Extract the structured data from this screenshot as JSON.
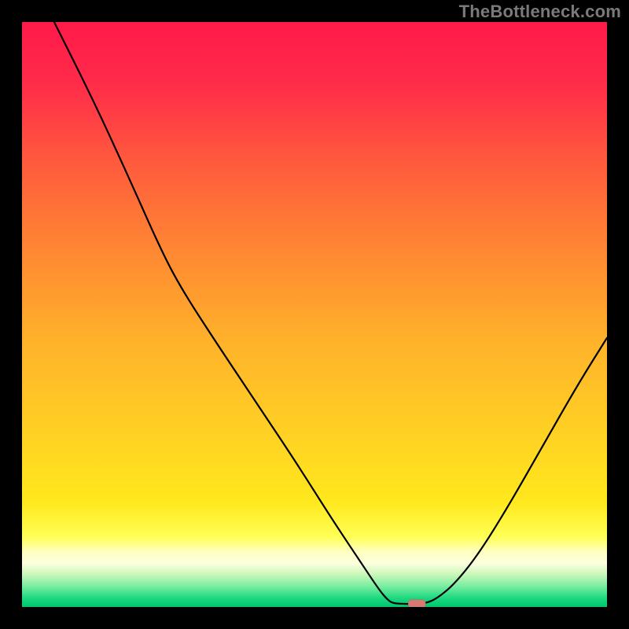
{
  "watermark": "TheBottleneck.com",
  "chart_data": {
    "type": "line",
    "title": "",
    "xlabel": "",
    "ylabel": "",
    "xlim": [
      0,
      100
    ],
    "ylim": [
      0,
      100
    ],
    "curve_points": [
      {
        "x": 5.5,
        "y": 100.0
      },
      {
        "x": 12.0,
        "y": 87.0
      },
      {
        "x": 18.0,
        "y": 74.0
      },
      {
        "x": 24.0,
        "y": 60.5
      },
      {
        "x": 27.5,
        "y": 54.0
      },
      {
        "x": 33.0,
        "y": 45.5
      },
      {
        "x": 40.0,
        "y": 35.0
      },
      {
        "x": 47.0,
        "y": 24.5
      },
      {
        "x": 53.0,
        "y": 15.0
      },
      {
        "x": 58.0,
        "y": 7.5
      },
      {
        "x": 61.0,
        "y": 3.0
      },
      {
        "x": 62.5,
        "y": 1.2
      },
      {
        "x": 63.5,
        "y": 0.6
      },
      {
        "x": 66.0,
        "y": 0.5
      },
      {
        "x": 69.0,
        "y": 0.6
      },
      {
        "x": 71.0,
        "y": 1.5
      },
      {
        "x": 74.0,
        "y": 4.0
      },
      {
        "x": 78.0,
        "y": 9.0
      },
      {
        "x": 83.0,
        "y": 17.0
      },
      {
        "x": 89.0,
        "y": 27.5
      },
      {
        "x": 95.0,
        "y": 38.0
      },
      {
        "x": 100.0,
        "y": 46.0
      }
    ],
    "min_marker": {
      "x": 67.5,
      "y": 0.5
    },
    "gradient_stops": [
      {
        "offset": 0.0,
        "color": "#ff1a4a"
      },
      {
        "offset": 0.1,
        "color": "#ff2a4a"
      },
      {
        "offset": 0.24,
        "color": "#ff5a3d"
      },
      {
        "offset": 0.4,
        "color": "#ff8a32"
      },
      {
        "offset": 0.55,
        "color": "#ffb32a"
      },
      {
        "offset": 0.7,
        "color": "#ffd024"
      },
      {
        "offset": 0.82,
        "color": "#ffe81d"
      },
      {
        "offset": 0.88,
        "color": "#ffff55"
      },
      {
        "offset": 0.905,
        "color": "#ffffc0"
      },
      {
        "offset": 0.925,
        "color": "#fdffde"
      },
      {
        "offset": 0.945,
        "color": "#c8f7b8"
      },
      {
        "offset": 0.965,
        "color": "#77eda0"
      },
      {
        "offset": 0.985,
        "color": "#1bd880"
      },
      {
        "offset": 1.0,
        "color": "#00c66f"
      }
    ]
  }
}
